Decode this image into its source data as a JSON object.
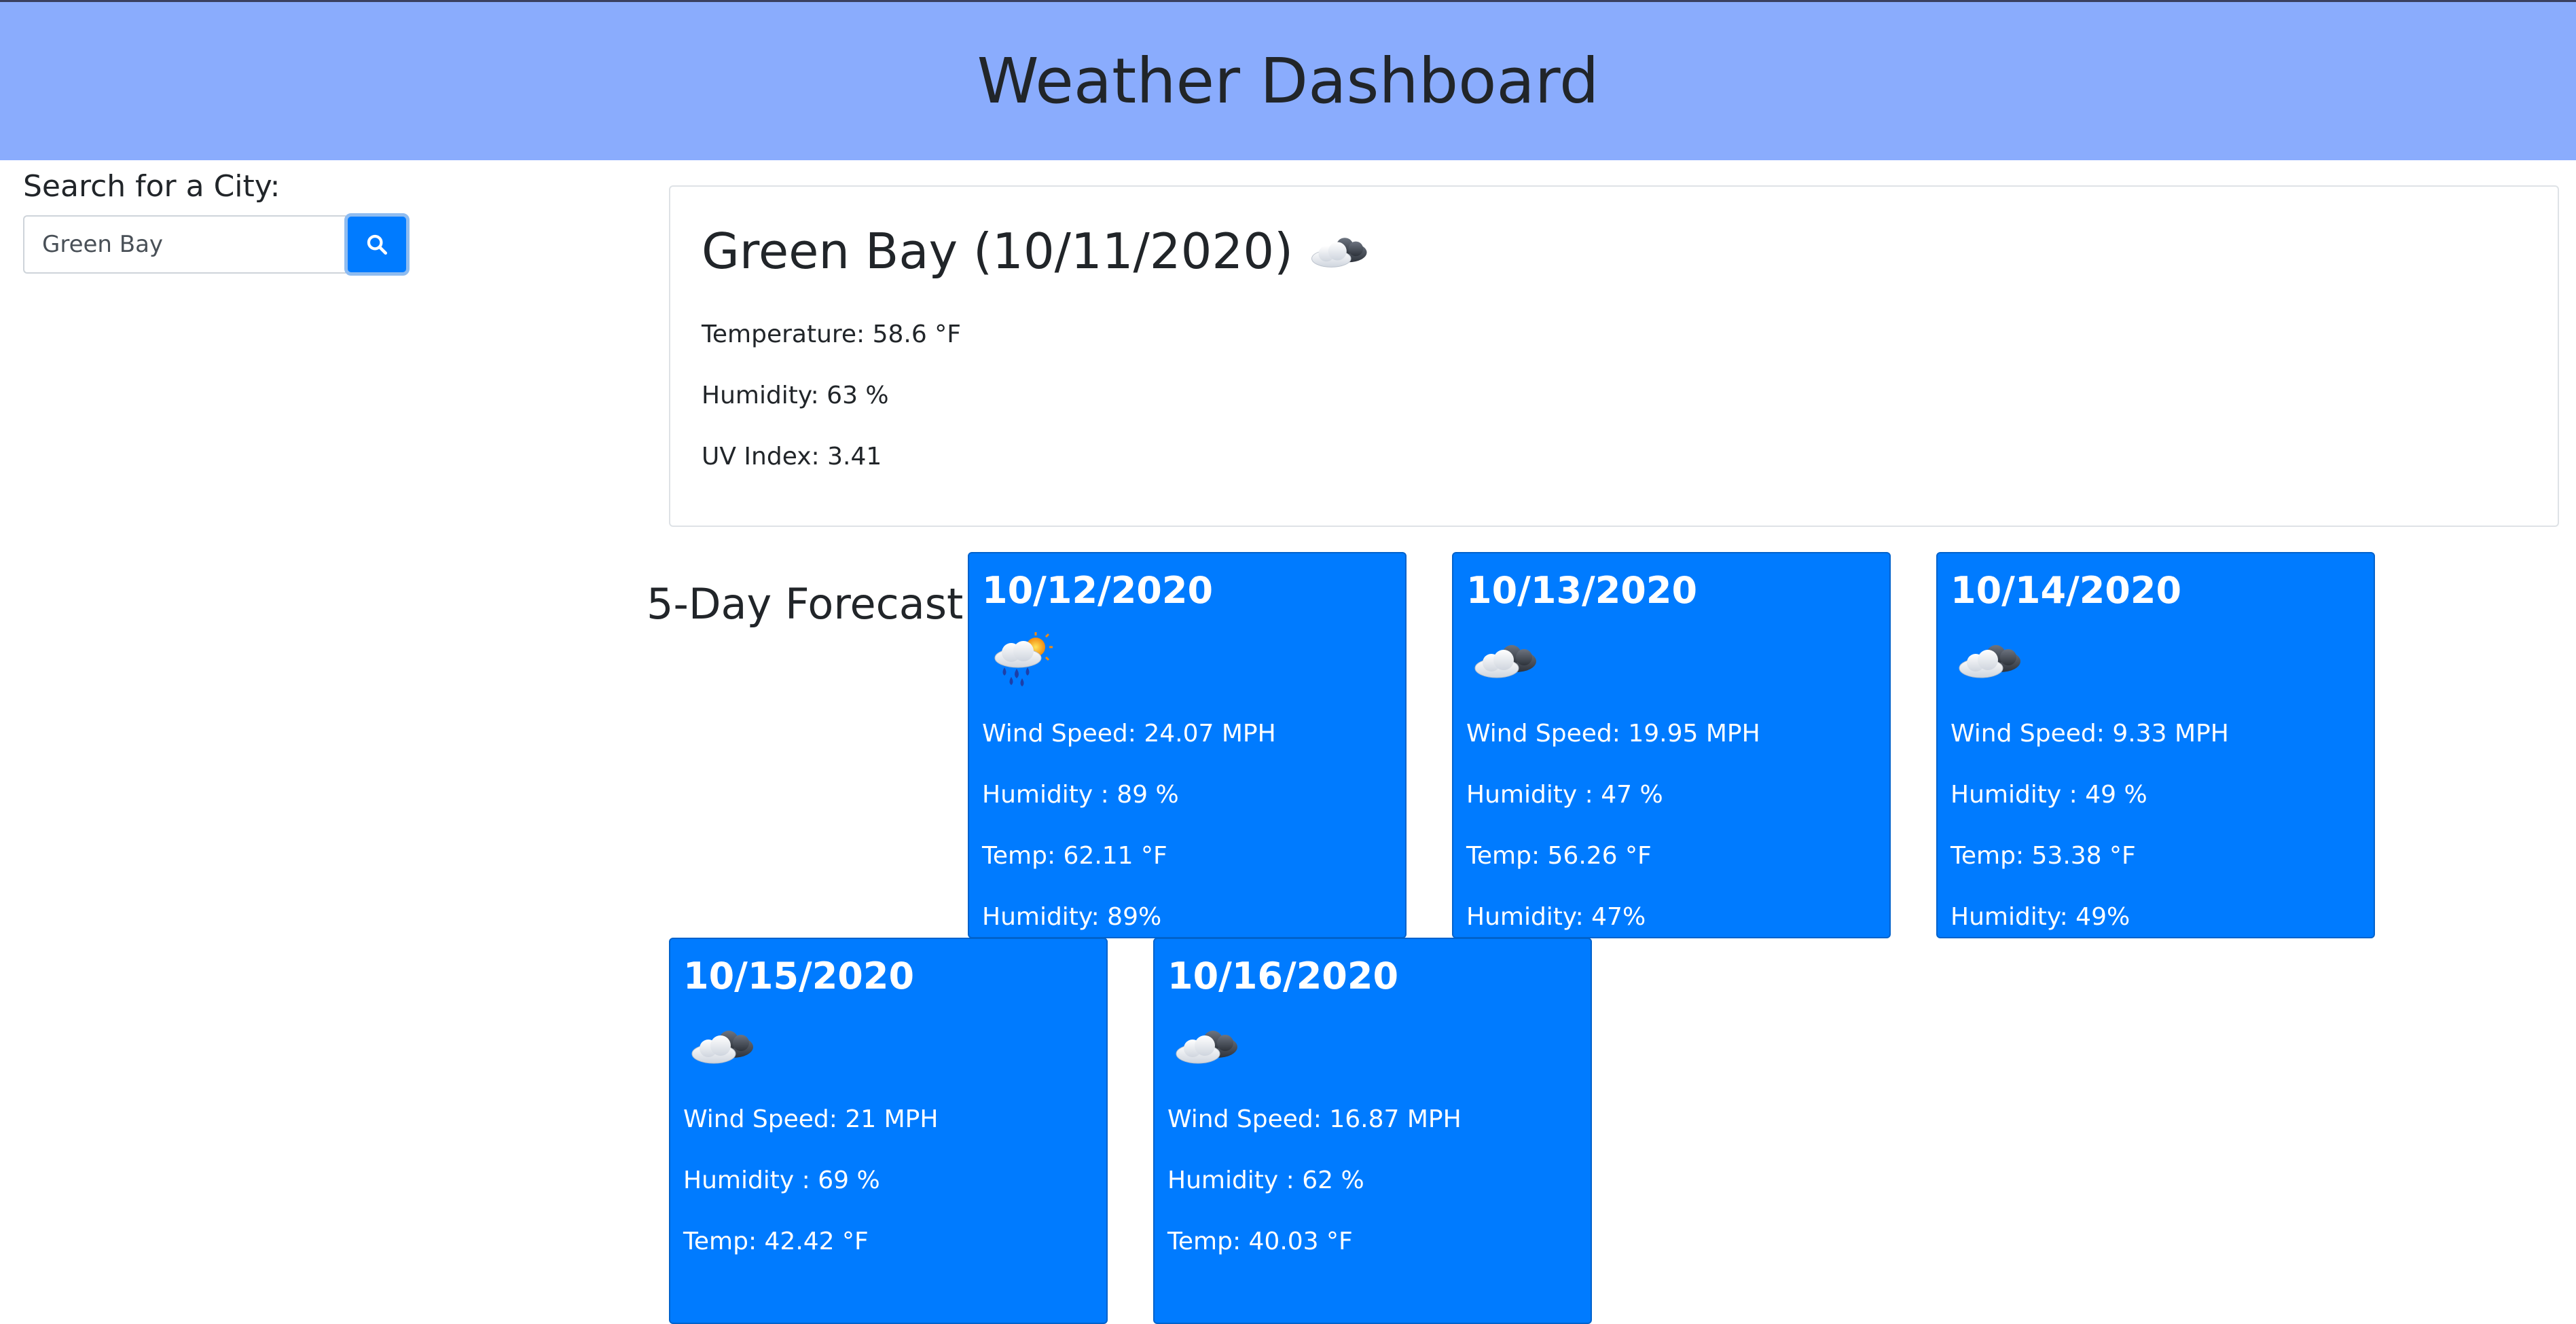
{
  "header": {
    "title": "Weather Dashboard"
  },
  "search": {
    "label": "Search for a City:",
    "value": "Green Bay",
    "button_icon": "search-icon"
  },
  "current": {
    "title": "Green Bay (10/11/2020)",
    "icon": "cloud-icon",
    "temperature": "Temperature: 58.6 °F",
    "humidity": "Humidity: 63 %",
    "uv_index": "UV Index: 3.41"
  },
  "forecast": {
    "label": "5-Day Forecast:",
    "days": [
      {
        "date": "10/12/2020",
        "icon": "rain-sun-icon",
        "wind": "Wind Speed: 24.07 MPH",
        "humidity1": "Humidity : 89 %",
        "temp": "Temp: 62.11 °F",
        "humidity2": "Humidity: 89%"
      },
      {
        "date": "10/13/2020",
        "icon": "cloud-icon",
        "wind": "Wind Speed: 19.95 MPH",
        "humidity1": "Humidity : 47 %",
        "temp": "Temp: 56.26 °F",
        "humidity2": "Humidity: 47%"
      },
      {
        "date": "10/14/2020",
        "icon": "cloud-icon",
        "wind": "Wind Speed: 9.33 MPH",
        "humidity1": "Humidity : 49 %",
        "temp": "Temp: 53.38 °F",
        "humidity2": "Humidity: 49%"
      },
      {
        "date": "10/15/2020",
        "icon": "cloud-icon",
        "wind": "Wind Speed: 21 MPH",
        "humidity1": "Humidity : 69 %",
        "temp": "Temp: 42.42 °F",
        "humidity2": ""
      },
      {
        "date": "10/16/2020",
        "icon": "cloud-icon",
        "wind": "Wind Speed: 16.87 MPH",
        "humidity1": "Humidity : 62 %",
        "temp": "Temp: 40.03 °F",
        "humidity2": ""
      }
    ]
  },
  "colors": {
    "header_bg": "#8aacfd",
    "card_bg": "#007bff",
    "button_bg": "#007bff"
  }
}
